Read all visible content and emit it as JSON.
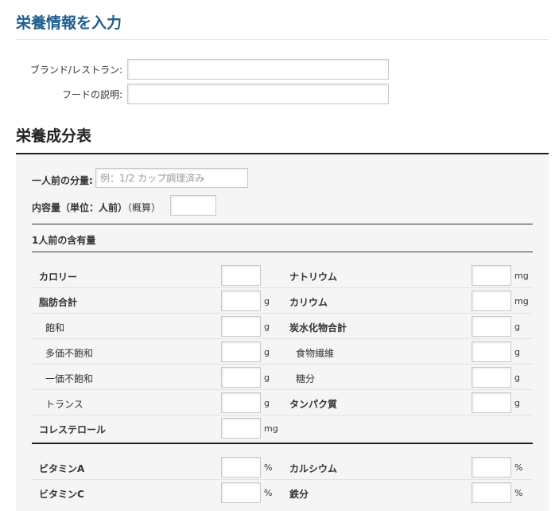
{
  "header": {
    "title": "栄養情報を入力"
  },
  "food_form": {
    "brand_label": "ブランド/レストラン:",
    "brand_value": "",
    "description_label": "フードの説明:",
    "description_value": ""
  },
  "nutrition": {
    "section_title": "栄養成分表",
    "serving_size_label": "一人前の分量:",
    "serving_size_placeholder": "例：1/2 カップ調理済み",
    "servings_label": "内容量（単位：人前）",
    "servings_approx": "（概算）",
    "per_serving_heading": "1人前の含有量",
    "rows": [
      {
        "left": {
          "label": "カロリー",
          "bold": true,
          "indent": 0,
          "unit": ""
        },
        "right": {
          "label": "ナトリウム",
          "bold": true,
          "indent": 0,
          "unit": "mg"
        }
      },
      {
        "left": {
          "label": "脂肪合計",
          "bold": true,
          "indent": 0,
          "unit": "g"
        },
        "right": {
          "label": "カリウム",
          "bold": true,
          "indent": 0,
          "unit": "mg"
        }
      },
      {
        "left": {
          "label": "飽和",
          "bold": false,
          "indent": 1,
          "unit": "g"
        },
        "right": {
          "label": "炭水化物合計",
          "bold": true,
          "indent": 0,
          "unit": "g"
        }
      },
      {
        "left": {
          "label": "多価不飽和",
          "bold": false,
          "indent": 1,
          "unit": "g"
        },
        "right": {
          "label": "食物繊維",
          "bold": false,
          "indent": 1,
          "unit": "g"
        }
      },
      {
        "left": {
          "label": "一価不飽和",
          "bold": false,
          "indent": 1,
          "unit": "g"
        },
        "right": {
          "label": "糖分",
          "bold": false,
          "indent": 1,
          "unit": "g"
        }
      },
      {
        "left": {
          "label": "トランス",
          "bold": false,
          "indent": 1,
          "unit": "g"
        },
        "right": {
          "label": "タンパク質",
          "bold": true,
          "indent": 0,
          "unit": "g"
        }
      },
      {
        "left": {
          "label": "コレステロール",
          "bold": true,
          "indent": 0,
          "unit": "mg"
        },
        "right": null
      }
    ],
    "vitamin_rows": [
      {
        "left": {
          "label": "ビタミンA",
          "bold": true,
          "indent": 0,
          "unit": "%"
        },
        "right": {
          "label": "カルシウム",
          "bold": true,
          "indent": 0,
          "unit": "%"
        }
      },
      {
        "left": {
          "label": "ビタミンC",
          "bold": true,
          "indent": 0,
          "unit": "%"
        },
        "right": {
          "label": "鉄分",
          "bold": true,
          "indent": 0,
          "unit": "%"
        }
      }
    ]
  }
}
